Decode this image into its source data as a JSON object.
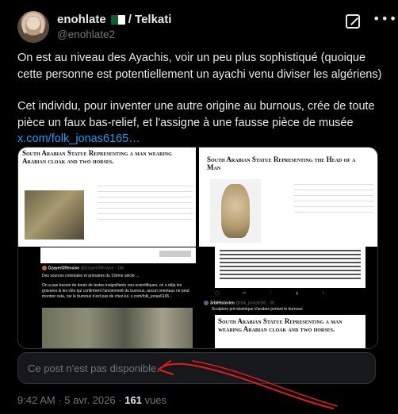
{
  "author": {
    "name": "enohlate",
    "badge_suffix": "/ Telkati",
    "handle": "@enohlate2",
    "flag_icon": "algeria-flag-icon",
    "flag_colors": [
      "#006233",
      "#ffffff",
      "#d21034"
    ]
  },
  "tweet": {
    "paragraph1": "On est au niveau des Ayachis, voir un peu plus sophistiqué (quoique cette personne est potentiellement un ayachi venu diviser les algériens)",
    "paragraph2": "Cet individu, pour inventer une autre origine au burnous, crée de toute pièce un faux bas-relief, et l'assigne à une fausse pièce de musée",
    "link_text": "x.com/folk_jonas6165…"
  },
  "media": {
    "left_top": {
      "doc_title": "South Arabian Statue Representing a man wearing Arabian cloak and two horses."
    },
    "left_bottom": {
      "user": "DzayerOffensive",
      "handle": "@DzayerOffensive · 14h",
      "line1": "Des sources coloniales et primaires du 19ème siècle ...",
      "line2": "On a pas besoin de bouts de textes insignifiants non-scientifiques, on a déjà les gravures & les clés qui confirment l'ancienneté du burnous, aucun orientaux ne peut montrer cela, car le burnous n'est pas de chez-lui.  x.com/folk_jonas6165..."
    },
    "right_top": {
      "doc_title": "South Arabian Statue Representing the Head of a Man"
    },
    "right_bottom": {
      "user": "3rbiHistorien",
      "handle": "@folk_jonas6165 · 3h",
      "line1": "Sculpture pré-islamique d'arabes portant le burnous",
      "doc_title": "South Arabian Statue Representing a man wearing Arabian cloak and two horses."
    }
  },
  "unavailable_text": "Ce post n'est pas disponible.",
  "footer": {
    "time": "9:42 AM",
    "sep1": "·",
    "date": "5 avr. 2026",
    "sep2": "·",
    "views_count": "161",
    "views_label": "vues"
  },
  "annotation_color": "#e01e1e"
}
